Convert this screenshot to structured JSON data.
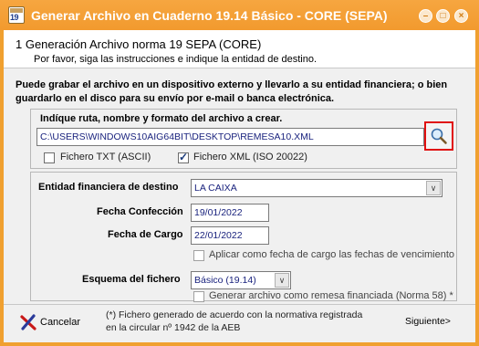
{
  "window": {
    "title": "Generar Archivo en Cuaderno 19.14 Básico - CORE (SEPA)",
    "app_icon_text": "19",
    "minimize_glyph": "–",
    "maximize_glyph": "□",
    "close_glyph": "×"
  },
  "header": {
    "step_title": "1  Generación Archivo norma 19 SEPA (CORE)",
    "step_subtitle": "Por favor, siga las instrucciones e indique la entidad de destino."
  },
  "intro_text": "Puede grabar el archivo en un dispositivo externo y llevarlo a su entidad financiera; o bien guardarlo en el disco para su envío por e-mail o banca electrónica.",
  "file_group": {
    "label": "Indíque ruta, nombre y formato del archivo a crear.",
    "path_value": "C:\\USERS\\WINDOWS10AIG64BIT\\DESKTOP\\REMESA10.XML",
    "search_icon": "magnifier-icon",
    "txt_label": "Fichero TXT (ASCII)",
    "txt_checked": false,
    "xml_label": "Fichero XML (ISO 20022)",
    "xml_checked": true
  },
  "bank_group": {
    "entity_label": "Entidad financiera de destino",
    "entity_value": "LA CAIXA",
    "confection_label": "Fecha Confección",
    "confection_value": "19/01/2022",
    "charge_label": "Fecha de Cargo",
    "charge_value": "22/01/2022",
    "apply_charge_label": "Aplicar como fecha de cargo las fechas de vencimiento",
    "apply_charge_checked": false,
    "scheme_label": "Esquema del fichero",
    "scheme_value": "Básico (19.14)",
    "financed_label": "Generar archivo como remesa financiada (Norma 58) *",
    "financed_checked": false
  },
  "footer": {
    "cancel_label": "Cancelar",
    "note_line1": "(*)  Fichero generado de acuerdo con la normativa registrada",
    "note_line2": "en la circular nº 1942 de la AEB",
    "next_label": "Siguiente>"
  },
  "colors": {
    "title_bar": "#f29a2e",
    "highlight_border": "#e01010",
    "input_text": "#1a237e"
  }
}
